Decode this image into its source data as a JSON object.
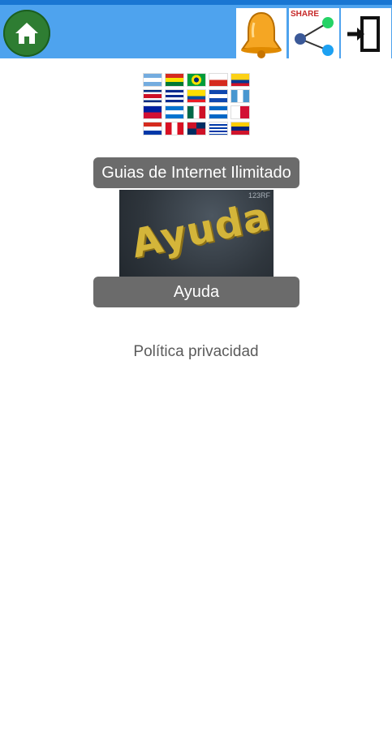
{
  "topbar": {
    "home_icon": "home-icon",
    "notifications_icon": "bell-icon",
    "share_icon": "share-icon",
    "share_label": "SHARE",
    "exit_icon": "exit-icon"
  },
  "flags": [
    {
      "name": "argentina-flag"
    },
    {
      "name": "bolivia-flag"
    },
    {
      "name": "brazil-flag"
    },
    {
      "name": "chile-flag"
    },
    {
      "name": "colombia-flag"
    },
    {
      "name": "costa-rica-flag"
    },
    {
      "name": "cuba-flag"
    },
    {
      "name": "ecuador-flag"
    },
    {
      "name": "el-salvador-flag"
    },
    {
      "name": "guatemala-flag"
    },
    {
      "name": "haiti-flag"
    },
    {
      "name": "honduras-flag"
    },
    {
      "name": "mexico-flag"
    },
    {
      "name": "nicaragua-flag"
    },
    {
      "name": "panama-flag"
    },
    {
      "name": "paraguay-flag"
    },
    {
      "name": "peru-flag"
    },
    {
      "name": "dominican-republic-flag"
    },
    {
      "name": "uruguay-flag"
    },
    {
      "name": "venezuela-flag"
    }
  ],
  "menu": {
    "guides_label": "Guias de Internet Ilimitado",
    "help_image_text": "Ayuda",
    "help_watermark": "123RF",
    "help_label": "Ayuda",
    "privacy_label": "Política privacidad"
  },
  "colors": {
    "topbar": "#4ea3ee",
    "home_button": "#2e7d32",
    "label_button": "#6b6b6b"
  }
}
